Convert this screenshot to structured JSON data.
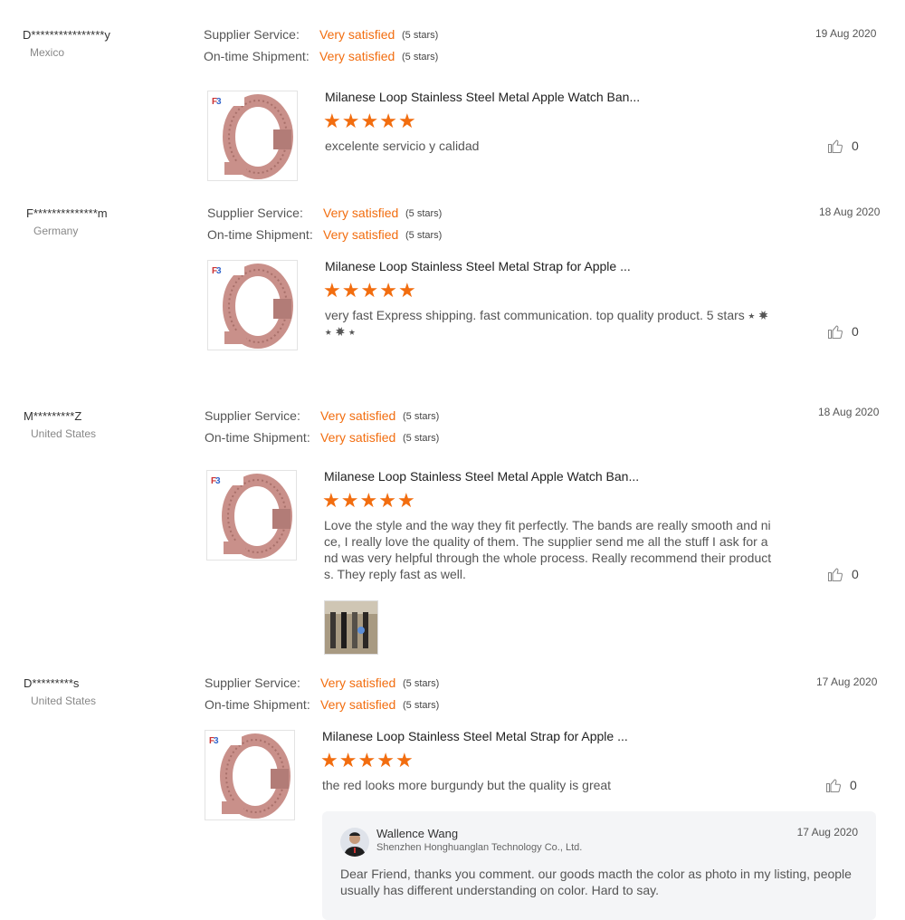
{
  "labels": {
    "supplier_service": "Supplier Service:",
    "ontime_shipment": "On-time Shipment:"
  },
  "colors": {
    "accent": "#f26d0f"
  },
  "reviews": [
    {
      "buyer": "D****************y",
      "country": "Mexico",
      "date": "19 Aug 2020",
      "supplier_value": "Very satisfied",
      "supplier_stars": "(5 stars)",
      "shipment_value": "Very satisfied",
      "shipment_stars": "(5 stars)",
      "product_title": "Milanese Loop Stainless Steel Metal Apple Watch Ban...",
      "rating": 5,
      "text": "excelente servicio y calidad",
      "likes": "0"
    },
    {
      "buyer": "F**************m",
      "country": "Germany",
      "date": "18 Aug 2020",
      "supplier_value": "Very satisfied",
      "supplier_stars": "(5 stars)",
      "shipment_value": "Very satisfied",
      "shipment_stars": "(5 stars)",
      "product_title": "Milanese Loop Stainless Steel Metal Strap for Apple ...",
      "rating": 5,
      "text": "very fast Express shipping. fast communication. top quality product. 5 stars ⭑ ✸ ⭑ ✸ ⭑",
      "likes": "0"
    },
    {
      "buyer": "M*********Z",
      "country": "United States",
      "date": "18 Aug 2020",
      "supplier_value": "Very satisfied",
      "supplier_stars": "(5 stars)",
      "shipment_value": "Very satisfied",
      "shipment_stars": "(5 stars)",
      "product_title": "Milanese Loop Stainless Steel Metal Apple Watch Ban...",
      "rating": 5,
      "text": "Love the style and the way they fit perfectly. The bands are really smooth and nice, I really love the quality of them. The supplier send me all the stuff I ask for and was very helpful through the whole process. Really recommend their products. They reply fast as well.",
      "likes": "0"
    },
    {
      "buyer": "D*********s",
      "country": "United States",
      "date": "17 Aug 2020",
      "supplier_value": "Very satisfied",
      "supplier_stars": "(5 stars)",
      "shipment_value": "Very satisfied",
      "shipment_stars": "(5 stars)",
      "product_title": "Milanese Loop Stainless Steel Metal Strap for Apple ...",
      "rating": 5,
      "text": "the red looks more burgundy but the quality is great",
      "likes": "0"
    }
  ],
  "reply": {
    "name": "Wallence Wang",
    "company": "Shenzhen Honghuanglan Technology Co., Ltd.",
    "date": "17 Aug 2020",
    "text": "Dear Friend,  thanks you comment. our goods macth the color as photo in my listing,  people usually has different understanding on color. Hard to say."
  },
  "icons": {
    "like": "thumbs-up-icon",
    "star": "star-icon"
  }
}
